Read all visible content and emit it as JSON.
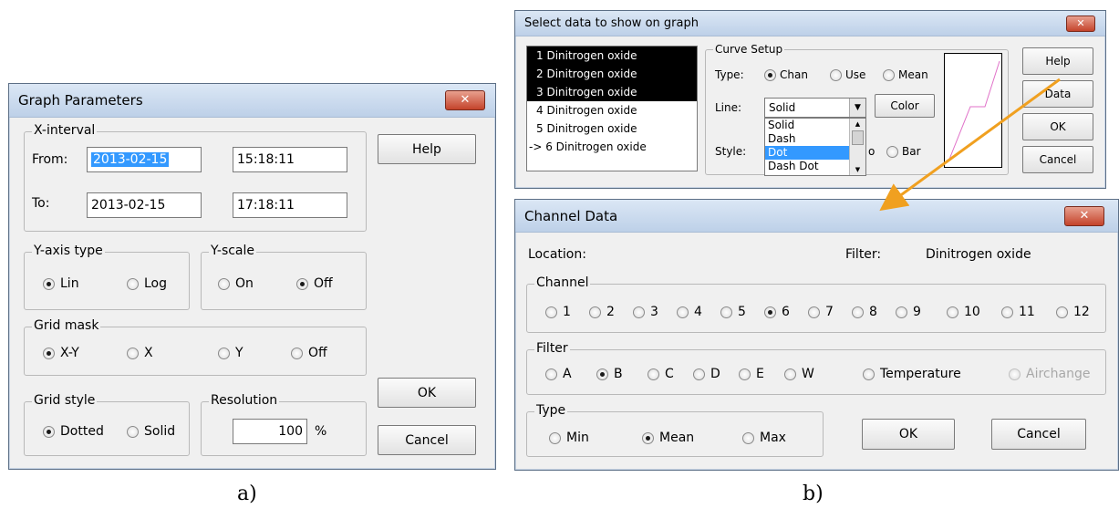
{
  "graph_parameters": {
    "title": "Graph Parameters",
    "close_glyph": "✕",
    "x_interval": {
      "legend": "X-interval",
      "from_label": "From:",
      "from_date": "2013-02-15",
      "from_time": "15:18:11",
      "to_label": "To:",
      "to_date": "2013-02-15",
      "to_time": "17:18:11"
    },
    "y_axis_type": {
      "legend": "Y-axis type",
      "options": [
        "Lin",
        "Log"
      ],
      "selected": "Lin"
    },
    "y_scale": {
      "legend": "Y-scale",
      "options": [
        "On",
        "Off"
      ],
      "selected": "Off"
    },
    "grid_mask": {
      "legend": "Grid mask",
      "options": [
        "X-Y",
        "X",
        "Y",
        "Off"
      ],
      "selected": "X-Y"
    },
    "grid_style": {
      "legend": "Grid style",
      "options": [
        "Dotted",
        "Solid"
      ],
      "selected": "Dotted"
    },
    "resolution": {
      "legend": "Resolution",
      "value": "100",
      "unit": "%"
    },
    "buttons": {
      "help": "Help",
      "ok": "OK",
      "cancel": "Cancel"
    }
  },
  "select_data": {
    "title": "Select data to show on graph",
    "close_glyph": "✕",
    "list": [
      {
        "label": "1  Dinitrogen oxide",
        "selected": true
      },
      {
        "label": "2  Dinitrogen oxide",
        "selected": true
      },
      {
        "label": "3  Dinitrogen oxide",
        "selected": true
      },
      {
        "label": "4  Dinitrogen oxide",
        "selected": false
      },
      {
        "label": "5  Dinitrogen oxide",
        "selected": false
      },
      {
        "label": "-> 6  Dinitrogen oxide",
        "selected": false
      }
    ],
    "curve_setup": {
      "legend": "Curve Setup",
      "type_label": "Type:",
      "type_options": [
        "Chan",
        "Use",
        "Mean"
      ],
      "type_selected": "Chan",
      "line_label": "Line:",
      "line_value": "Solid",
      "dropdown_items": [
        "Solid",
        "Dash",
        "Dot",
        "Dash Dot"
      ],
      "dropdown_highlight": "Dot",
      "color_button": "Color",
      "style_label": "Style:",
      "style_partial": "o",
      "style_bar": "Bar"
    },
    "buttons": {
      "help": "Help",
      "data": "Data",
      "ok": "OK",
      "cancel": "Cancel"
    },
    "preview_color": "#e070c8"
  },
  "channel_data": {
    "title": "Channel Data",
    "close_glyph": "✕",
    "location_label": "Location:",
    "filter_label": "Filter:",
    "filter_value": "Dinitrogen oxide",
    "channel": {
      "legend": "Channel",
      "options": [
        "1",
        "2",
        "3",
        "4",
        "5",
        "6",
        "7",
        "8",
        "9",
        "10",
        "11",
        "12"
      ],
      "selected": "6"
    },
    "filter": {
      "legend": "Filter",
      "options": [
        "A",
        "B",
        "C",
        "D",
        "E",
        "W",
        "Temperature",
        "Airchange"
      ],
      "selected": "B",
      "disabled": "Airchange"
    },
    "type": {
      "legend": "Type",
      "options": [
        "Min",
        "Mean",
        "Max"
      ],
      "selected": "Mean"
    },
    "buttons": {
      "ok": "OK",
      "cancel": "Cancel"
    }
  },
  "captions": {
    "a": "a)",
    "b": "b)"
  },
  "colors": {
    "arrow": "#f0a020",
    "selection": "#3399ff",
    "close": "#c4432b"
  }
}
